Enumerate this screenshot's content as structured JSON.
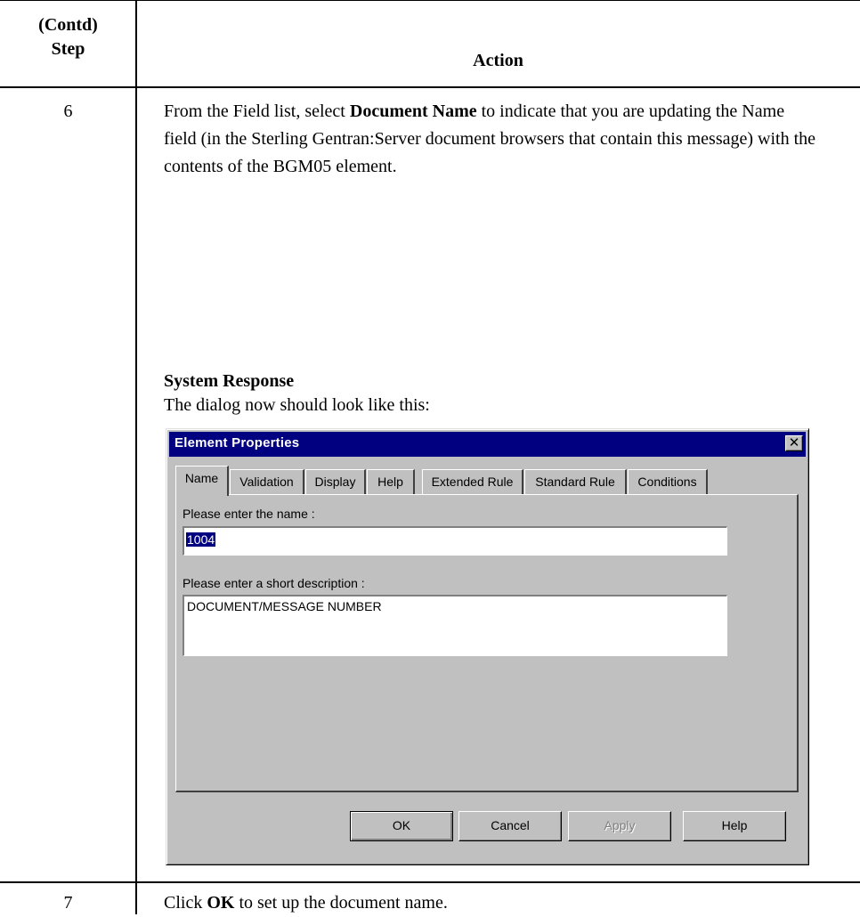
{
  "table": {
    "header_step_line1": "(Contd)",
    "header_step_line2": "Step",
    "header_action": "Action",
    "rows": [
      {
        "step": "6",
        "text_before_bold": "From the Field list, select ",
        "bold": "Document Name",
        "text_after_bold": " to indicate that you are updating the Name field (in the Sterling Gentran:Server document browsers that contain this message) with the contents of the BGM05 element.",
        "system_response_heading": "System Response",
        "system_response_text": "The dialog now should look like this:"
      },
      {
        "step": "7",
        "text_before_bold": "Click ",
        "bold": "OK",
        "text_after_bold": " to set up the document name."
      }
    ]
  },
  "dialog": {
    "title": "Element Properties",
    "close_glyph": "✕",
    "tabs": [
      "Name",
      "Validation",
      "Display",
      "Help",
      "Extended Rule",
      "Standard Rule",
      "Conditions"
    ],
    "active_tab": "Name",
    "name_label": "Please enter the name :",
    "name_value": "1004",
    "description_label": "Please enter a short description :",
    "description_value": "DOCUMENT/MESSAGE NUMBER",
    "buttons": {
      "ok": "OK",
      "cancel": "Cancel",
      "apply": "Apply",
      "help": "Help"
    }
  }
}
